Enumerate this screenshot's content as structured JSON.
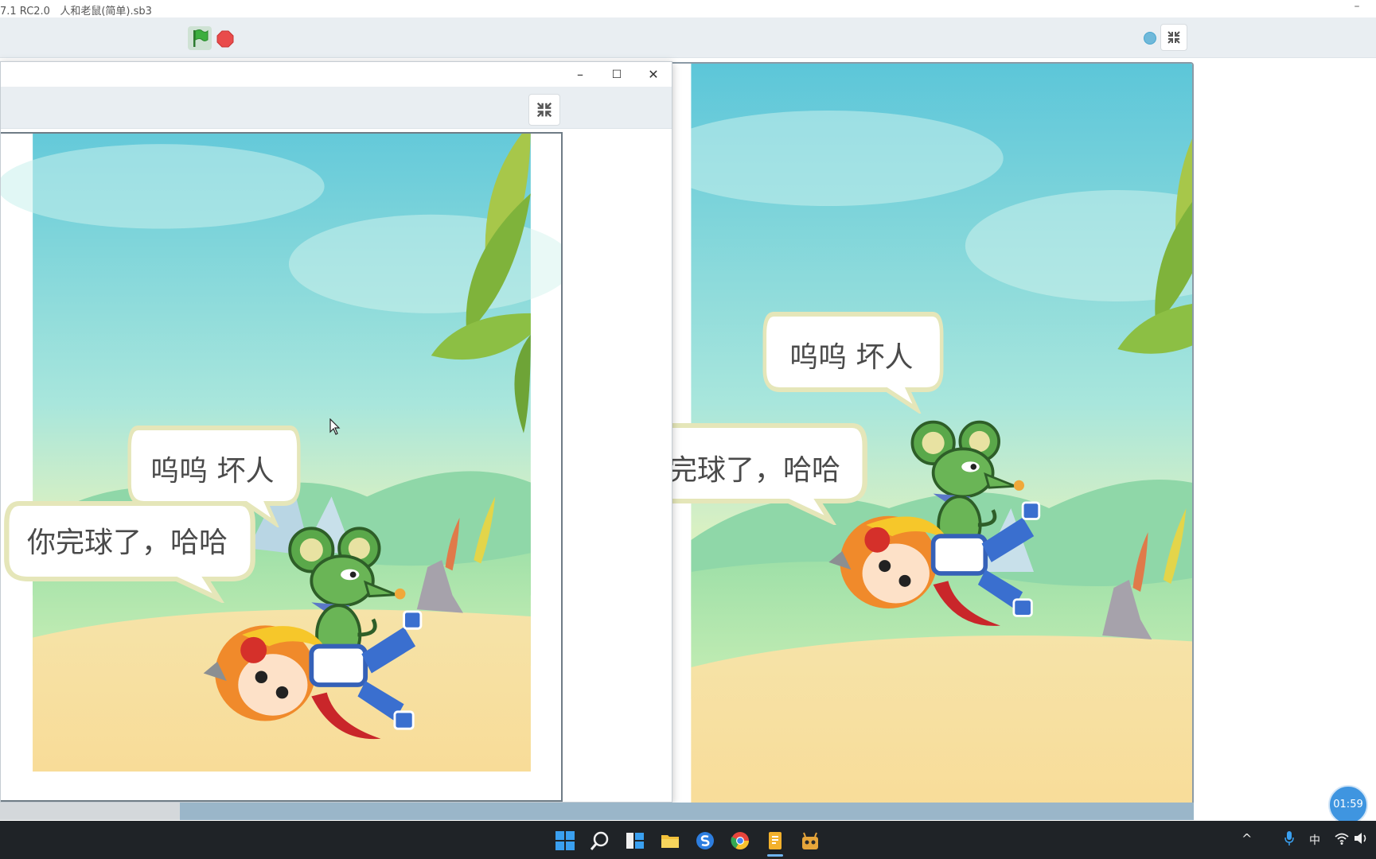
{
  "window": {
    "title": "7.1 RC2.0   人和老鼠(简单).sb3",
    "minimize_glyph": "–"
  },
  "toolbar": {
    "flag_icon": "green-flag-icon",
    "stop_icon": "stop-icon",
    "shrink_icon": "shrink-icon"
  },
  "inner_window": {
    "minimize_glyph": "–",
    "maximize_glyph": "☐",
    "close_glyph": "✕"
  },
  "stage": {
    "bubble_villain": "你完球了，哈哈",
    "bubble_villain_clipped": "你完球了，哈哈",
    "bubble_hero": "呜呜 坏人"
  },
  "timer": {
    "label": "01:59"
  },
  "taskbar": {
    "apps": [
      "windows-start-icon",
      "search-icon",
      "task-view-icon",
      "file-explorer-icon",
      "sogou-browser-icon",
      "chrome-icon",
      "notes-app-icon",
      "scratch-player-icon"
    ],
    "tray_ime": "中",
    "tray_chevron": "^"
  },
  "colors": {
    "sky_top": "#7fd0d8",
    "sand": "#f6dfa0",
    "accent_blue": "#3f95e0"
  }
}
